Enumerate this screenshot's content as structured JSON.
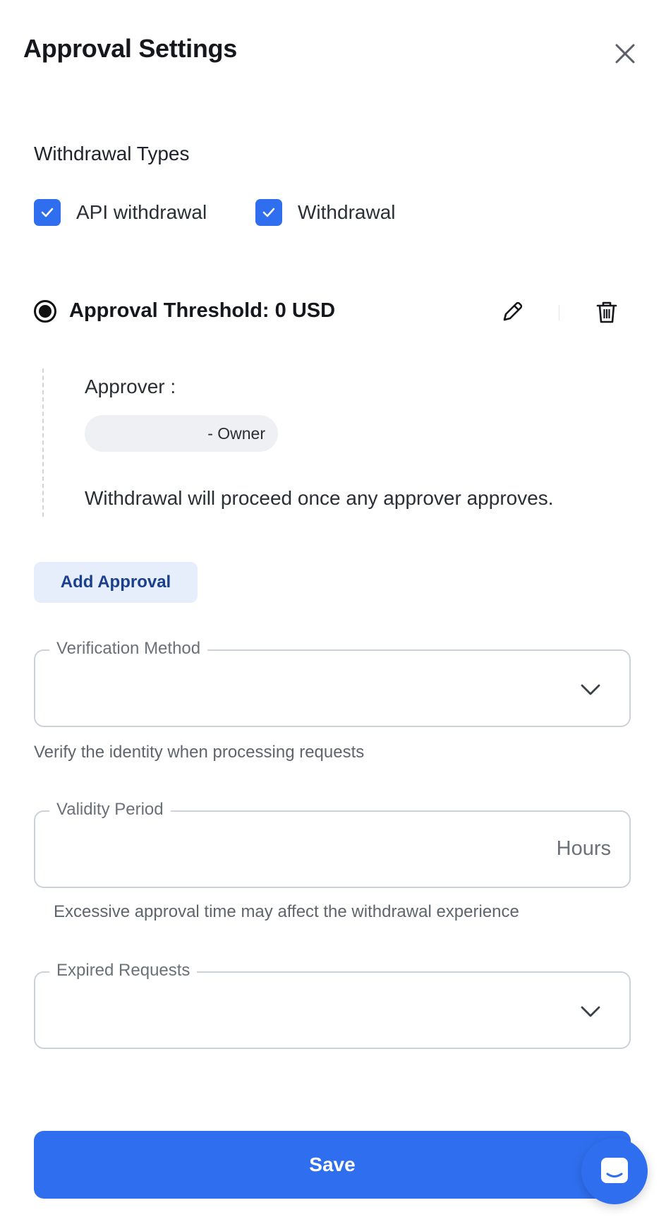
{
  "header": {
    "title": "Approval Settings",
    "close_icon": "close-icon"
  },
  "withdrawal_types": {
    "label": "Withdrawal Types",
    "options": [
      {
        "label": "API withdrawal",
        "checked": true
      },
      {
        "label": "Withdrawal",
        "checked": true
      }
    ]
  },
  "threshold": {
    "label": "Approval Threshold: 0 USD",
    "selected": true,
    "edit_icon": "pencil-icon",
    "delete_icon": "trash-icon",
    "approver_label": "Approver :",
    "approver_role": "- Owner",
    "note": "Withdrawal will proceed once any approver approves."
  },
  "add_approval_label": "Add Approval",
  "verification_method": {
    "label": "Verification Method",
    "value": "",
    "helper": "Verify the identity when processing requests"
  },
  "validity_period": {
    "label": "Validity Period",
    "value": "",
    "suffix": "Hours",
    "helper": "Excessive approval time may affect the withdrawal experience"
  },
  "expired_requests": {
    "label": "Expired Requests",
    "value": ""
  },
  "save_label": "Save",
  "colors": {
    "primary": "#2f6fef",
    "primary_light": "#e6eefc",
    "text": "#1a1d24",
    "muted": "#6b7079",
    "border": "#cdd1d8"
  }
}
